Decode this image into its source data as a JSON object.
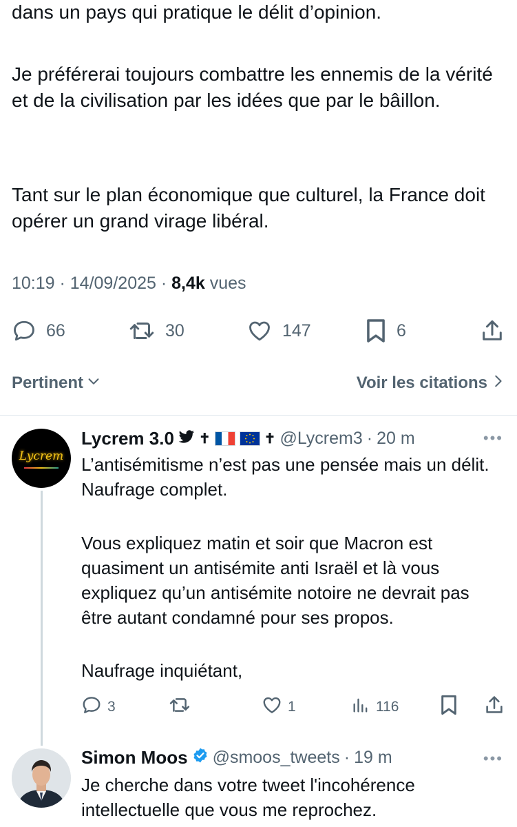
{
  "tweet": {
    "paragraphs": [
      "dans un pays qui pratique le délit d’opinion.",
      "Je préférerai toujours combattre les ennemis de la vérité et de la civilisation par les idées que par le bâillon.",
      "Tant sur le plan économique que culturel, la France doit opérer un grand virage libéral."
    ],
    "time": "10:19 · 14/09/2025 · ",
    "views_count": "8,4k",
    "views_label": " vues",
    "stats": {
      "replies": "66",
      "retweets": "30",
      "likes": "147",
      "bookmarks": "6"
    }
  },
  "sort": {
    "left": "Pertinent",
    "right": "Voir les citations"
  },
  "replies": [
    {
      "name": "Lycrem 3.0",
      "extra_symbol": "✝",
      "handle": "@Lycrem3",
      "time_sep": "·",
      "time": "20 m",
      "more": "•••",
      "avatar_text": "Lycrem",
      "paragraphs": [
        "L’antisémitisme n’est pas une pensée mais un délit. Naufrage complet.",
        "Vous expliquez matin et soir que Macron est quasiment un antisémite anti Israël et là vous expliquez qu’un antisémite notoire ne devrait pas être autant condamné pour ses propos.",
        "Naufrage inquiétant,"
      ],
      "stats": {
        "replies": "3",
        "retweets": "",
        "likes": "1",
        "views": "116"
      }
    },
    {
      "name": "Simon Moos",
      "handle": "@smoos_tweets",
      "time_sep": "·",
      "time": "19 m",
      "more": "•••",
      "paragraphs": [
        "Je cherche dans votre tweet l'incohérence intellectuelle que vous me reprochez."
      ]
    }
  ],
  "colors": {
    "text": "#0f1419",
    "muted": "#536471",
    "verified": "#1d9bf0",
    "divider": "#e1e8ed"
  },
  "icons": [
    "reply-icon",
    "retweet-icon",
    "like-icon",
    "bookmark-icon",
    "share-icon",
    "chevron-down-icon",
    "chevron-right-icon",
    "bird-icon",
    "cross-icon",
    "france-flag-icon",
    "eu-flag-icon",
    "verified-badge-icon",
    "views-icon"
  ]
}
